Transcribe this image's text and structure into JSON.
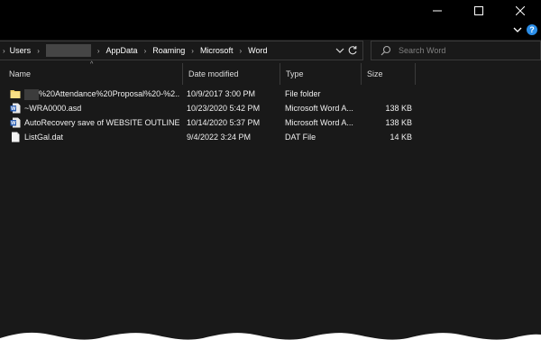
{
  "window": {
    "icons": {
      "minimize": "minimize-icon",
      "maximize": "maximize-icon",
      "close": "close-icon"
    }
  },
  "ribbon": {
    "expand_icon": "chevron-down-icon",
    "help_label": "?"
  },
  "breadcrumb": {
    "items": [
      "Users",
      "",
      "AppData",
      "Roaming",
      "Microsoft",
      "Word"
    ],
    "separator": "›",
    "root_chevron": "›"
  },
  "search": {
    "placeholder": "Search Word",
    "icon": "search-icon"
  },
  "columns": [
    {
      "label": "Name"
    },
    {
      "label": "Date modified"
    },
    {
      "label": "Type"
    },
    {
      "label": "Size"
    }
  ],
  "sort_indicator": "^",
  "files": [
    {
      "name": "%20Attendance%20Proposal%20-%2...",
      "date": "10/9/2017 3:00 PM",
      "type": "File folder",
      "size": "",
      "icon": "folder-icon",
      "name_redacted": true
    },
    {
      "name": "~WRA0000.asd",
      "date": "10/23/2020 5:42 PM",
      "type": "Microsoft Word A...",
      "size": "138 KB",
      "icon": "word-file-icon",
      "name_redacted": false
    },
    {
      "name": "AutoRecovery save of WEBSITE OUTLINE ...",
      "date": "10/14/2020 5:37 PM",
      "type": "Microsoft Word A...",
      "size": "138 KB",
      "icon": "word-file-icon",
      "name_redacted": false
    },
    {
      "name": "ListGal.dat",
      "date": "9/4/2022 3:24 PM",
      "type": "DAT File",
      "size": "14 KB",
      "icon": "file-icon",
      "name_redacted": false
    }
  ],
  "colors": {
    "background": "#191919",
    "titlebar": "#000000",
    "accent": "#2b8ee8",
    "folder": "#f3d36b"
  }
}
